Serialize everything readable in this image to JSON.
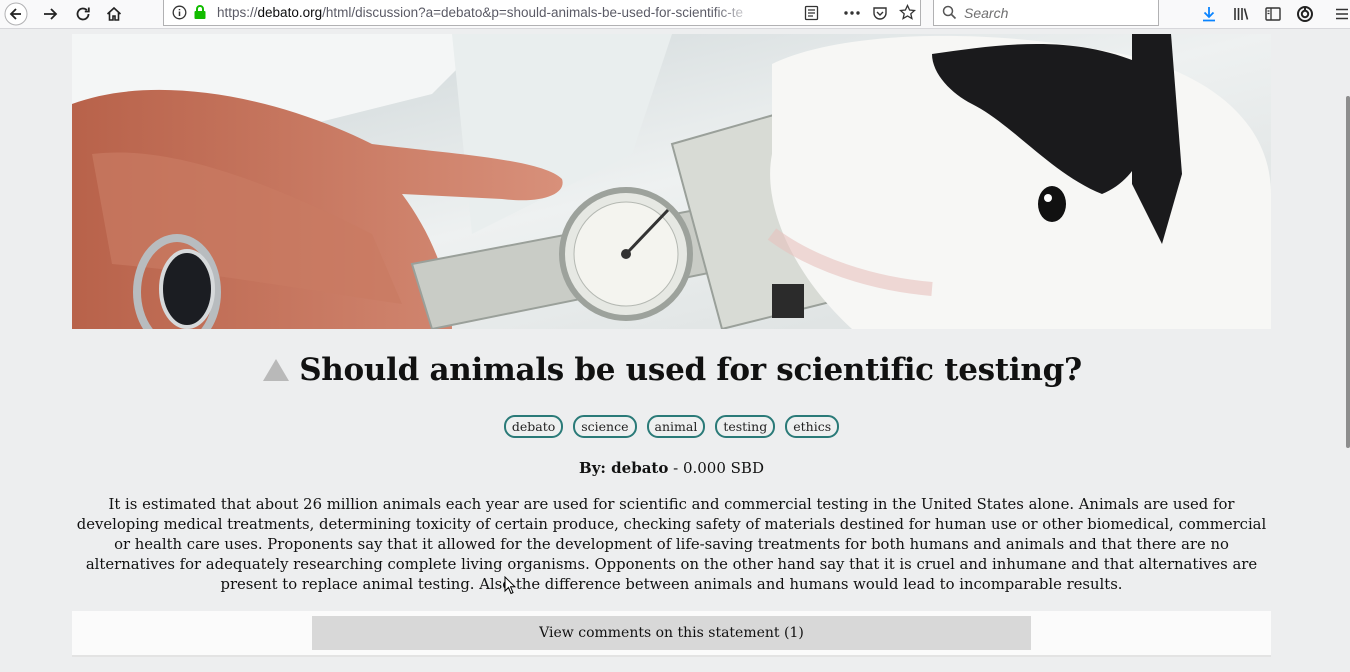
{
  "browser": {
    "url_prefix": "https://",
    "url_domain": "debato.org",
    "url_path": "/html/discussion?a=debato&p=should-animals-be-used-for-scientific-te",
    "search_placeholder": "Search"
  },
  "icons": {
    "back": "back-arrow-icon",
    "forward": "forward-arrow-icon",
    "reload": "reload-icon",
    "home": "home-icon",
    "info": "info-icon",
    "lock": "lock-icon",
    "reader": "reader-view-icon",
    "more": "ellipsis-icon",
    "pocket": "pocket-icon",
    "bookmark": "star-icon",
    "download": "download-arrow-icon",
    "library": "library-icon",
    "sidebar": "sidebar-icon",
    "sync": "sync-account-icon",
    "menu": "hamburger-menu-icon",
    "vote": "upvote-triangle-icon"
  },
  "colors": {
    "page_bg": "#edeeef",
    "tag_border": "#2a7a78",
    "lock_green": "#12bc00",
    "download_blue": "#0a84ff",
    "button_bg": "#d8d8d8"
  },
  "post": {
    "title": "Should animals be used for scientific testing?",
    "tags": [
      "debato",
      "science",
      "animal",
      "testing",
      "ethics"
    ],
    "by_label": "By: debato",
    "payout": " - 0.000 SBD",
    "description": "It is estimated that about 26 million animals each year are used for scientific and commercial testing in the United States alone. Animals are used for developing medical treatments, determining toxicity of certain produce, checking safety of materials destined for human use or other biomedical, commercial or health care uses. Proponents say that it allowed for the development of life-saving treatments for both humans and animals and that there are no alternatives for adequately researching complete living organisms. Opponents on the other hand say that it is cruel and inhumane and that alternatives are present to replace animal testing. Also the difference between animals and humans would lead to incomparable results.",
    "comments_button": "View comments on this statement (1)"
  }
}
